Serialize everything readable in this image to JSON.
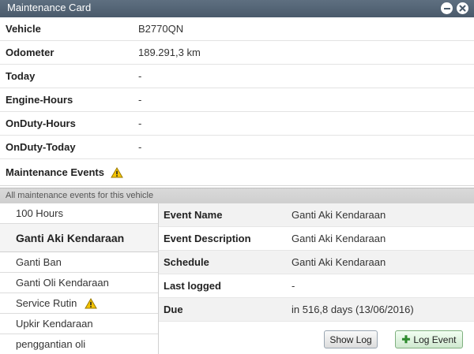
{
  "window": {
    "title": "Maintenance Card"
  },
  "info": {
    "vehicle_label": "Vehicle",
    "vehicle_value": "B2770QN",
    "odometer_label": "Odometer",
    "odometer_value": "189.291,3 km",
    "today_label": "Today",
    "today_value": "-",
    "engine_hours_label": "Engine-Hours",
    "engine_hours_value": "-",
    "onduty_hours_label": "OnDuty-Hours",
    "onduty_hours_value": "-",
    "onduty_today_label": "OnDuty-Today",
    "onduty_today_value": "-",
    "events_label": "Maintenance Events",
    "events_icon": "warning-icon"
  },
  "subheader": "All maintenance events for this vehicle",
  "events": [
    {
      "name": "100 Hours",
      "selected": false,
      "warning": false
    },
    {
      "name": "Ganti Aki Kendaraan",
      "selected": true,
      "warning": false
    },
    {
      "name": "Ganti Ban",
      "selected": false,
      "warning": false
    },
    {
      "name": "Ganti Oli Kendaraan",
      "selected": false,
      "warning": false
    },
    {
      "name": "Service Rutin",
      "selected": false,
      "warning": true
    },
    {
      "name": "Upkir Kendaraan",
      "selected": false,
      "warning": false
    },
    {
      "name": "penggantian oli",
      "selected": false,
      "warning": false
    }
  ],
  "details": {
    "event_name_label": "Event Name",
    "event_name_value": "Ganti Aki Kendaraan",
    "event_description_label": "Event Description",
    "event_description_value": "Ganti Aki Kendaraan",
    "schedule_label": "Schedule",
    "schedule_value": "Ganti Aki Kendaraan",
    "last_logged_label": "Last logged",
    "last_logged_value": "-",
    "due_label": "Due",
    "due_value": "in 516,8 days (13/06/2016)"
  },
  "buttons": {
    "show_log": "Show Log",
    "log_event": "Log Event"
  },
  "colors": {
    "titlebar": "#4a5a6b",
    "warning": "#f5c400",
    "log_event_plus": "#2d8a2d"
  }
}
